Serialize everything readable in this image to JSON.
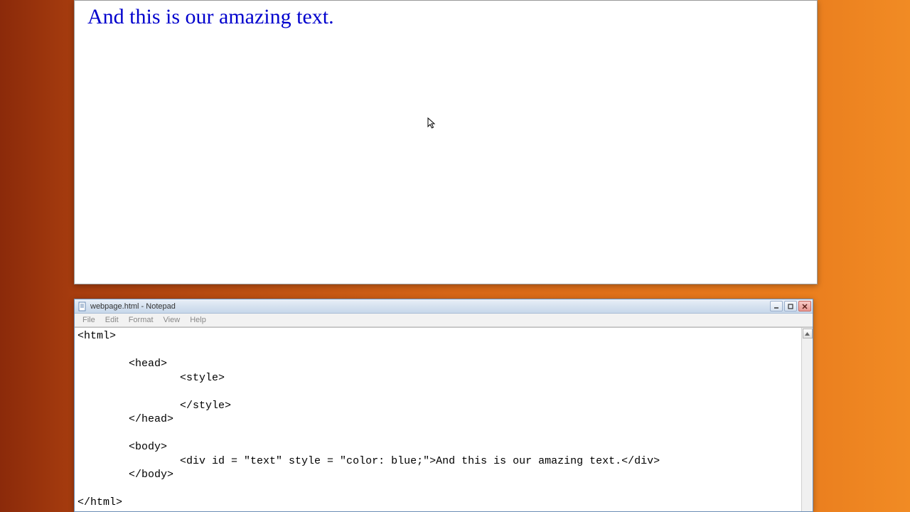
{
  "browser": {
    "rendered_text": "And this is our amazing text."
  },
  "notepad": {
    "title": "webpage.html - Notepad",
    "menu": {
      "file": "File",
      "edit": "Edit",
      "format": "Format",
      "view": "View",
      "help": "Help"
    },
    "code": "<html>\n\n        <head>\n                <style>\n\n                </style>\n        </head>\n\n        <body>\n                <div id = \"text\" style = \"color: blue;\">And this is our amazing text.</div>\n        </body>\n\n</html>"
  }
}
